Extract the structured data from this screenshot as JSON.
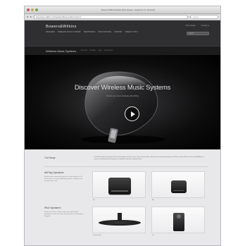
{
  "browser": {
    "window_title": "Bowers & Wilkins Wireless Music Systems - Zeppelin Air, A7, A5 and Z2",
    "url": "www.bowers-wilkins.com/Speakers/Wireless-Music-Systems",
    "search_placeholder": "Google"
  },
  "header": {
    "logo": "Bowers&Wilkins",
    "nav": [
      "Speakers",
      "Wireless Music Systems",
      "Headphones",
      "Discover B&W",
      "Support",
      "Where to buy"
    ],
    "top_links": [
      "Find a dealer",
      "Contact us"
    ],
    "search_placeholder": "Search"
  },
  "subnav": {
    "title": "Wireless Music Systems",
    "links": [
      "Overview",
      "Compare",
      "Apps",
      "Accessories"
    ]
  },
  "hero": {
    "title": "Discover Wireless Music Systems",
    "subtitle": "Stream your music wirelessly with AirPlay"
  },
  "range": {
    "title": "The Range",
    "text": "Our Wireless Music Systems bring outstanding sound to every room of your home. Stream music wirelessly from your iPhone, iPad, iPod or iTunes with AirPlay, or connect via Bluetooth and enjoy rich, detailed audio with minimal effort."
  },
  "products": [
    {
      "name": "AirPlay Speakers",
      "desc": "Stream music wirelessly from your iTunes library or iOS device with our range of AirPlay speakers. Simple to set up and easy to use.",
      "tiles": [
        "A7",
        "A5"
      ]
    },
    {
      "name": "iPod Speakers",
      "desc": "Dock your iPod or iPhone and enjoy superb audio performance from our iconic iPod speakers, including the Zeppelin.",
      "tiles": [
        "Zeppelin Air",
        "Z2"
      ]
    }
  ],
  "colors": {
    "header_bg": "#2f2f31",
    "subnav_bg": "#1c1c1d",
    "content_bg": "#e8e8ea"
  }
}
